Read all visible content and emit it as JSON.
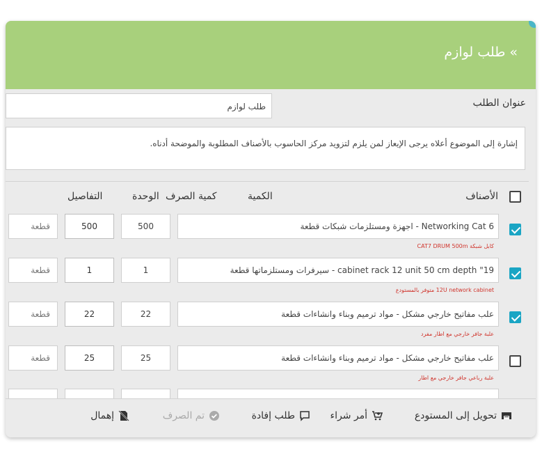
{
  "dialog": {
    "title": "» طلب لوازم"
  },
  "form": {
    "subject_label": "عنوان الطلب",
    "subject_value": "طلب لوازم",
    "body_text": "إشارة إلى الموضوع أعلاه يرجى الإيعاز لمن يلزم لتزويد مركز الحاسوب بالأصناف المطلوبة والموضحة أدناه."
  },
  "table": {
    "headers": {
      "items": "الأصناف",
      "quantity": "الكمية",
      "spent_quantity": "كمية الصرف",
      "unit": "الوحدة",
      "details": "التفاصيل"
    },
    "rows": [
      {
        "checked": true,
        "item": "Networking Cat 6  -  اجهزة ومستلزمات شبكات  قطعة",
        "quantity": "500",
        "spent": "500",
        "unit": "قطعة",
        "note": "كابل شبكة CAT7 DRUM 500m"
      },
      {
        "checked": true,
        "item": "19\" cabinet rack 12 unit 50 cm depth  -  سيرفرات ومستلزماتها  قطعة",
        "quantity": "1",
        "spent": "1",
        "unit": "قطعة",
        "note": "12U network cabinet متوفر بالمستودع"
      },
      {
        "checked": true,
        "item": "علب مفاتيح خارجي مشكل  -  مواد ترميم وبناء وانشاءات  قطعة",
        "quantity": "22",
        "spent": "22",
        "unit": "قطعة",
        "note": "علبة جافر خارجي مع اطار مفرد"
      },
      {
        "checked": false,
        "item": "علب مفاتيح خارجي مشكل  -  مواد ترميم وبناء وانشاءات  قطعة",
        "quantity": "25",
        "spent": "25",
        "unit": "قطعة",
        "note": "علبة رباعي جافر خارجي مع اطار"
      }
    ]
  },
  "footer": {
    "transfer_label": "تحويل إلى المستودع",
    "purchase_label": "أمر شراء",
    "request_label": "طلب إفادة",
    "done_label": "تم الصرف",
    "ignore_label": "إهمال"
  },
  "colors": {
    "header_green": "#a8d07c",
    "check_blue": "#1aa5c4",
    "note_red": "#d0342c"
  }
}
